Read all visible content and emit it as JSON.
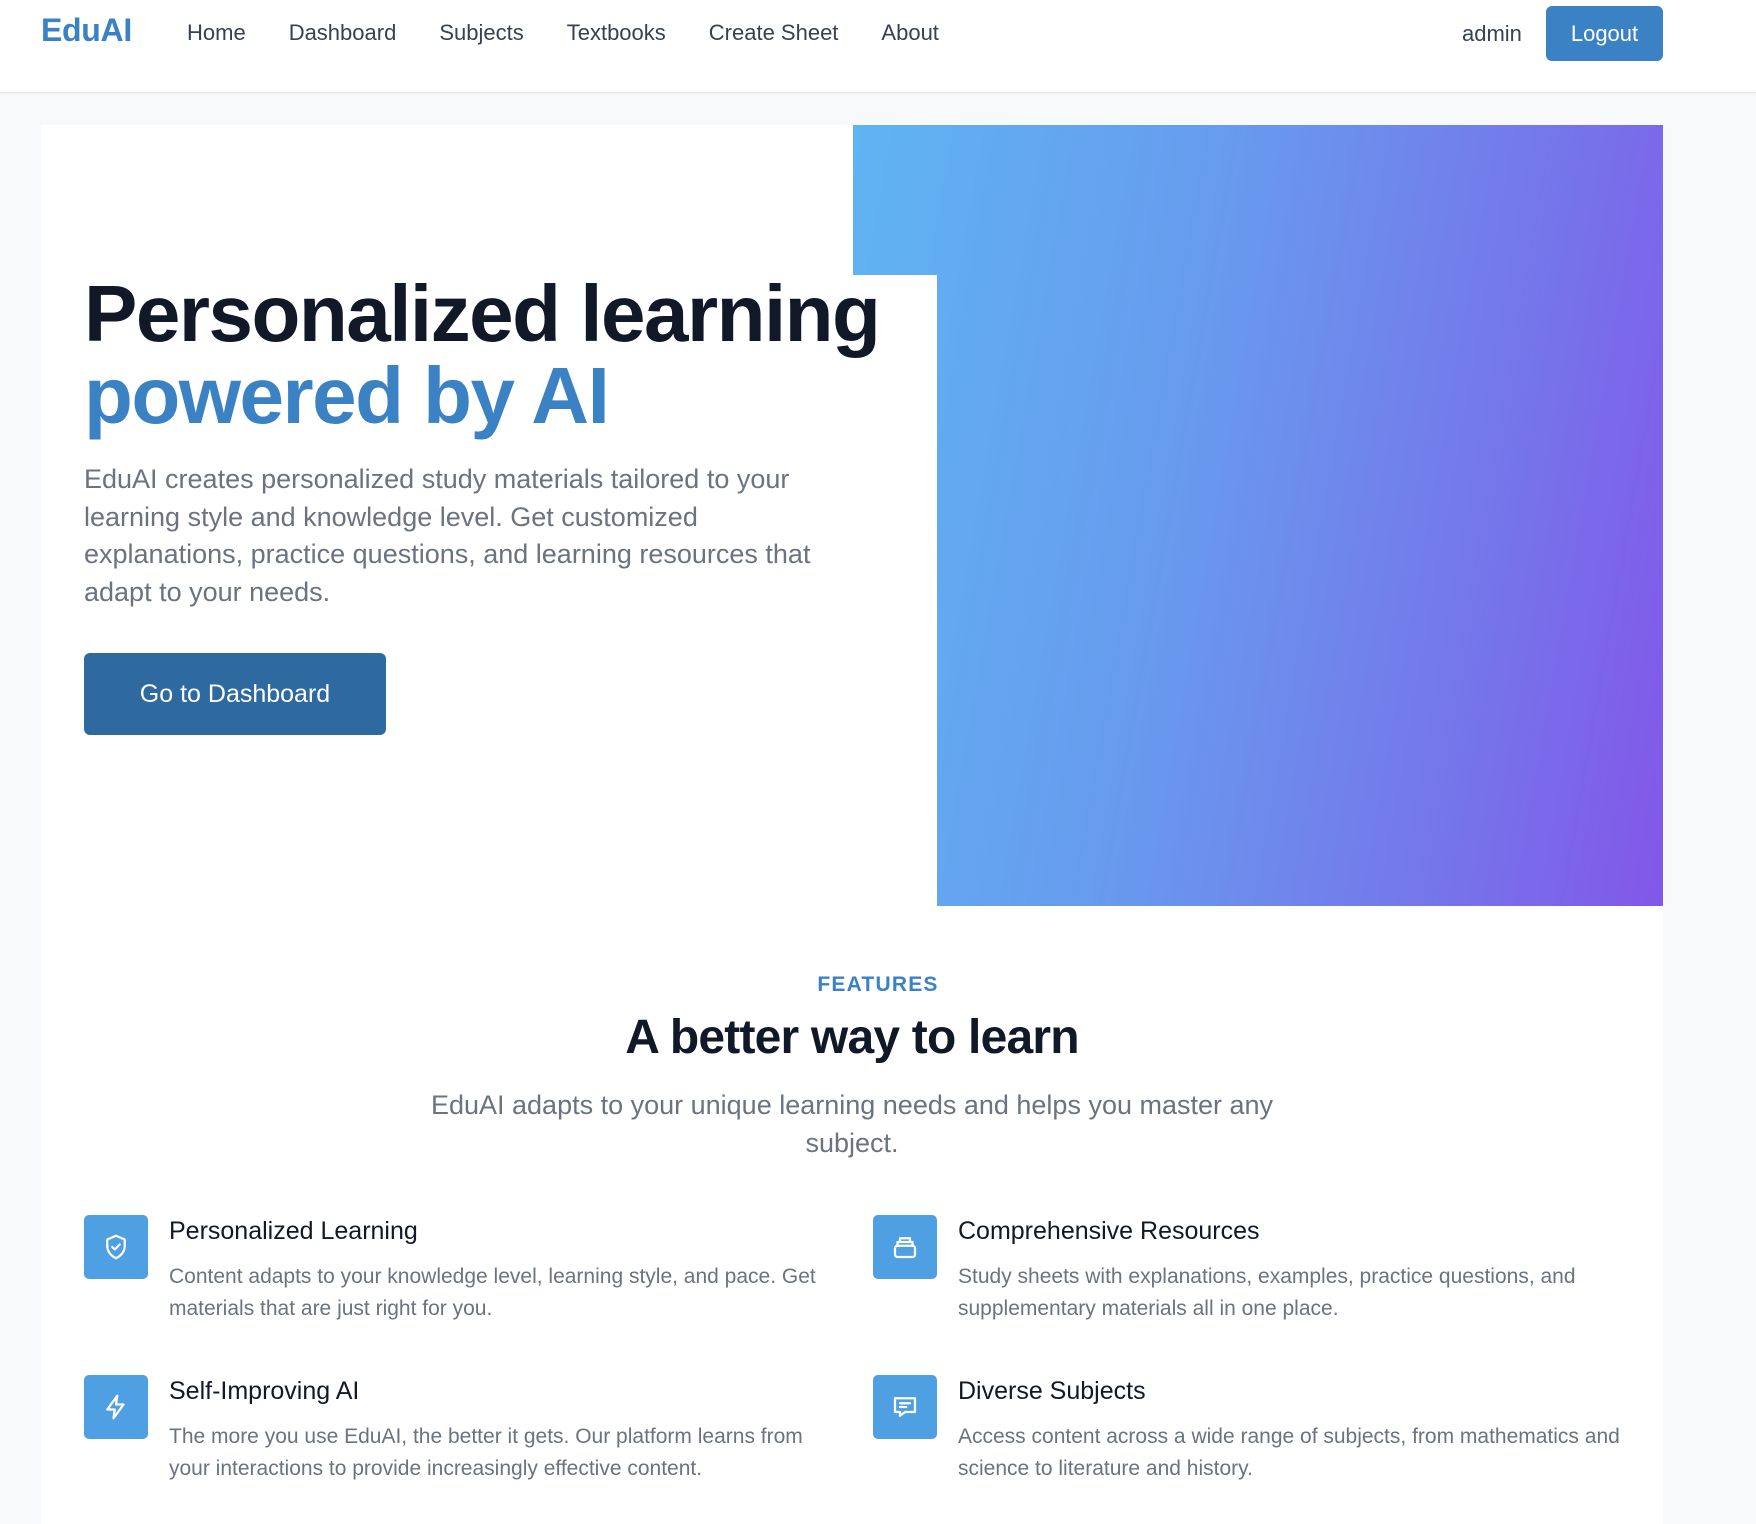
{
  "brand": "EduAI",
  "nav": {
    "links": [
      "Home",
      "Dashboard",
      "Subjects",
      "Textbooks",
      "Create Sheet",
      "About"
    ],
    "user": "admin",
    "logout_label": "Logout"
  },
  "hero": {
    "title_line1": "Personalized learning",
    "title_line2": "powered by AI",
    "description": "EduAI creates personalized study materials tailored to your learning style and knowledge level. Get customized explanations, practice questions, and learning resources that adapt to your needs.",
    "cta_label": "Go to Dashboard"
  },
  "features": {
    "eyebrow": "FEATURES",
    "title": "A better way to learn",
    "subtitle": "EduAI adapts to your unique learning needs and helps you master any subject.",
    "items": [
      {
        "icon": "shield-check-icon",
        "title": "Personalized Learning",
        "description": "Content adapts to your knowledge level, learning style, and pace. Get materials that are just right for you."
      },
      {
        "icon": "stack-icon",
        "title": "Comprehensive Resources",
        "description": "Study sheets with explanations, examples, practice questions, and supplementary materials all in one place."
      },
      {
        "icon": "lightning-icon",
        "title": "Self-Improving AI",
        "description": "The more you use EduAI, the better it gets. Our platform learns from your interactions to provide increasingly effective content."
      },
      {
        "icon": "chat-icon",
        "title": "Diverse Subjects",
        "description": "Access content across a wide range of subjects, from mathematics and science to literature and history."
      }
    ]
  },
  "colors": {
    "accent": "#3a82c4",
    "cta": "#2e6aa0",
    "gradient_start": "#5fb4f2",
    "gradient_end": "#8257e9",
    "icon_bg": "#4f9fe3"
  }
}
